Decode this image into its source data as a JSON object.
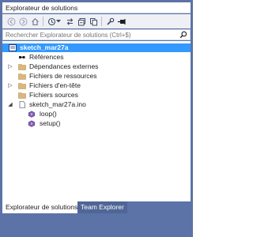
{
  "window": {
    "title": "Explorateur de solutions"
  },
  "toolbar": {
    "buttons": [
      "back-icon",
      "forward-icon",
      "home-icon",
      "history-icon",
      "sync-icon",
      "collapse-icon",
      "copy-icon",
      "properties-icon",
      "pin-icon"
    ]
  },
  "search": {
    "placeholder": "Rechercher Explorateur de solutions (Ctrl+$)",
    "icon": "search-icon"
  },
  "tree": {
    "items": [
      {
        "label": "sketch_mar27a",
        "icon": "project-icon",
        "selected": true
      },
      {
        "label": "Références",
        "icon": "references-icon"
      },
      {
        "label": "Dépendances externes",
        "icon": "folder-icon"
      },
      {
        "label": "Fichiers de ressources",
        "icon": "folder-icon"
      },
      {
        "label": "Fichiers d'en-tête",
        "icon": "folder-icon"
      },
      {
        "label": "Fichiers sources",
        "icon": "folder-icon"
      },
      {
        "label": "sketch_mar27a.ino",
        "icon": "file-icon"
      },
      {
        "label": "loop()",
        "icon": "method-icon"
      },
      {
        "label": "setup()",
        "icon": "method-icon"
      }
    ]
  },
  "tabs": [
    {
      "label": "Explorateur de solutions",
      "active": true
    },
    {
      "label": "Team Explorer",
      "active": false
    }
  ],
  "colors": {
    "frame": "#5b73a6",
    "selection": "#3399ff",
    "folder": "#dcb67a"
  }
}
